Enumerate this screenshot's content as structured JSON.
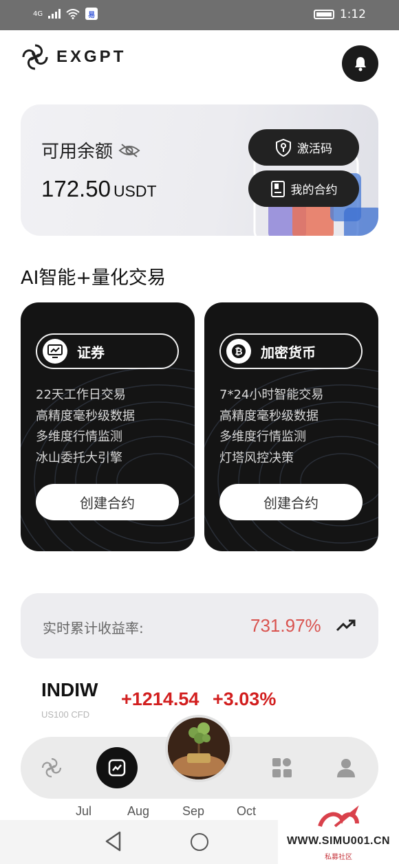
{
  "status_bar": {
    "signal": "4G",
    "time": "1:12"
  },
  "header": {
    "logo_text": "EXGPT",
    "bell_icon": "bell-icon"
  },
  "balance": {
    "label": "可用余额",
    "amount": "172.50",
    "unit": "USDT",
    "activate_label": "激活码",
    "contracts_label": "我的合约"
  },
  "section_title": "AI智能+量化交易",
  "products": [
    {
      "title": "证券",
      "icon": "chart-monitor-icon",
      "features": [
        "22天工作日交易",
        "高精度毫秒级数据",
        "多维度行情监测",
        "冰山委托大引擎"
      ],
      "button": "创建合约"
    },
    {
      "title": "加密货币",
      "icon": "bitcoin-icon",
      "features": [
        "7*24小时智能交易",
        "高精度毫秒级数据",
        "多维度行情监测",
        "灯塔风控决策"
      ],
      "button": "创建合约"
    }
  ],
  "return_rate": {
    "label": "实时累计收益率:",
    "value": "731.97%",
    "value_color": "#d9534f"
  },
  "ticker": {
    "name": "INDIW",
    "sub": "US100 CFD",
    "change": "+1214.54",
    "percent": "+3.03%",
    "color": "#d21f1f"
  },
  "months": [
    "Jul",
    "Aug",
    "Sep",
    "Oct"
  ],
  "watermark": {
    "text": "WWW.SIMU001.CN",
    "sub": "私募社区"
  }
}
